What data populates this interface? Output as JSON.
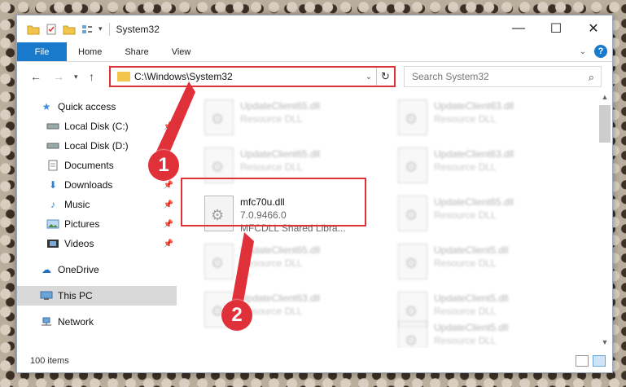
{
  "window": {
    "title": "System32",
    "controls": {
      "minimize": "—",
      "maximize": "☐",
      "close": "✕"
    }
  },
  "ribbon": {
    "tabs": [
      "File",
      "Home",
      "Share",
      "View"
    ],
    "help": "?"
  },
  "address": {
    "path": "C:\\Windows\\System32",
    "search_placeholder": "Search System32"
  },
  "sidebar": {
    "items": [
      {
        "label": "Quick access",
        "icon": "star-icon",
        "pinned": false
      },
      {
        "label": "Local Disk (C:)",
        "icon": "drive-icon",
        "pinned": true
      },
      {
        "label": "Local Disk (D:)",
        "icon": "drive-icon",
        "pinned": true
      },
      {
        "label": "Documents",
        "icon": "documents-icon",
        "pinned": true
      },
      {
        "label": "Downloads",
        "icon": "download-icon",
        "pinned": true
      },
      {
        "label": "Music",
        "icon": "music-icon",
        "pinned": true
      },
      {
        "label": "Pictures",
        "icon": "pictures-icon",
        "pinned": true
      },
      {
        "label": "Videos",
        "icon": "videos-icon",
        "pinned": true
      },
      {
        "label": "OneDrive",
        "icon": "cloud-icon",
        "pinned": false
      },
      {
        "label": "This PC",
        "icon": "computer-icon",
        "pinned": false,
        "selected": true
      },
      {
        "label": "Network",
        "icon": "network-icon",
        "pinned": false
      }
    ]
  },
  "files": {
    "background": [
      {
        "name": "UpdateClient65.dll",
        "type": "Resource DLL"
      },
      {
        "name": "UpdateClient63.dll",
        "type": "Resource DLL"
      },
      {
        "name": "UpdateClient65.dll",
        "type": "Resource DLL"
      },
      {
        "name": "UpdateClient63.dll",
        "type": "Resource DLL"
      },
      {
        "name": "UpdateClient65.dll",
        "type": "Resource DLL"
      },
      {
        "name": "UpdateClient5.dll",
        "type": "Resource DLL"
      },
      {
        "name": "UpdateClient65.dll",
        "type": "Resource DLL"
      },
      {
        "name": "UpdateClient5.dll",
        "type": "Resource DLL"
      },
      {
        "name": "UpdateClient63.dll",
        "type": "Resource DLL"
      },
      {
        "name": "UpdateClient5.dll",
        "type": "Resource DLL"
      }
    ],
    "focused": {
      "name": "mfc70u.dll",
      "version": "7.0.9466.0",
      "description": "MFCDLL Shared Libra..."
    }
  },
  "status": {
    "count": "100 items"
  },
  "callouts": [
    "1",
    "2"
  ],
  "colors": {
    "accent": "#1979ca",
    "highlight": "#e0303a"
  }
}
